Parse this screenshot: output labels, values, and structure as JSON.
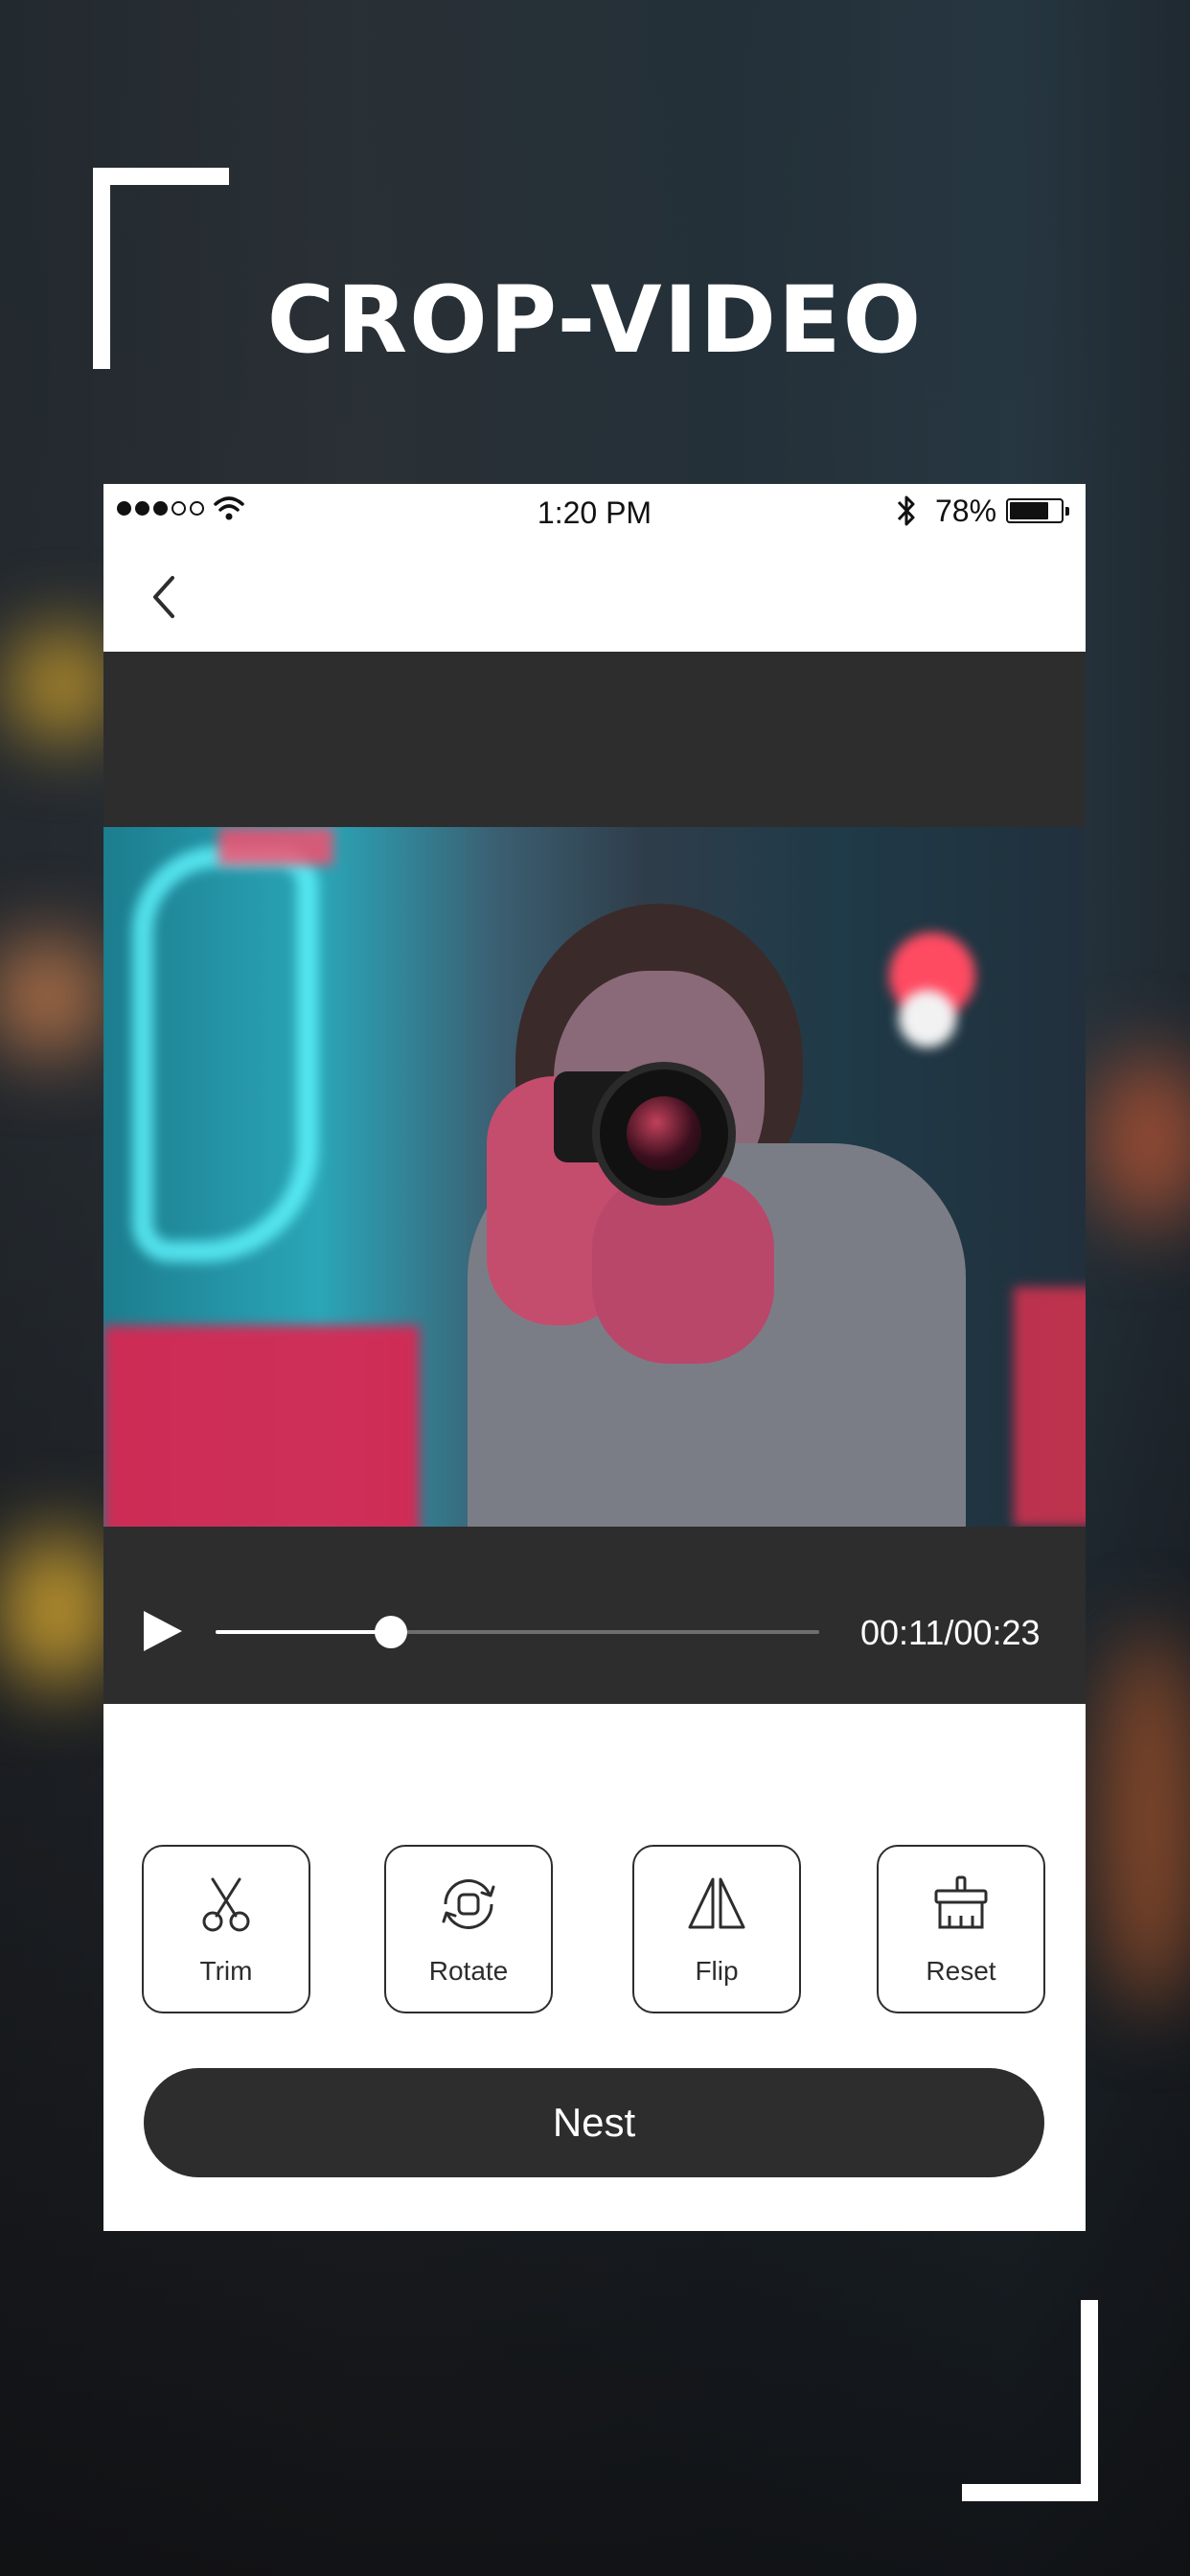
{
  "headline": "CROP-VIDEO",
  "status_bar": {
    "time": "1:20 PM",
    "battery": "78%"
  },
  "player": {
    "time_display": "00:11/00:23",
    "progress": 0.29
  },
  "tools": [
    {
      "label": "Trim",
      "icon": "scissors-icon"
    },
    {
      "label": "Rotate",
      "icon": "rotate-icon"
    },
    {
      "label": "Flip",
      "icon": "flip-icon"
    },
    {
      "label": "Reset",
      "icon": "brush-icon"
    }
  ],
  "primary_button": "Nest",
  "colors": {
    "dark": "#2d2d2d",
    "white": "#ffffff"
  }
}
